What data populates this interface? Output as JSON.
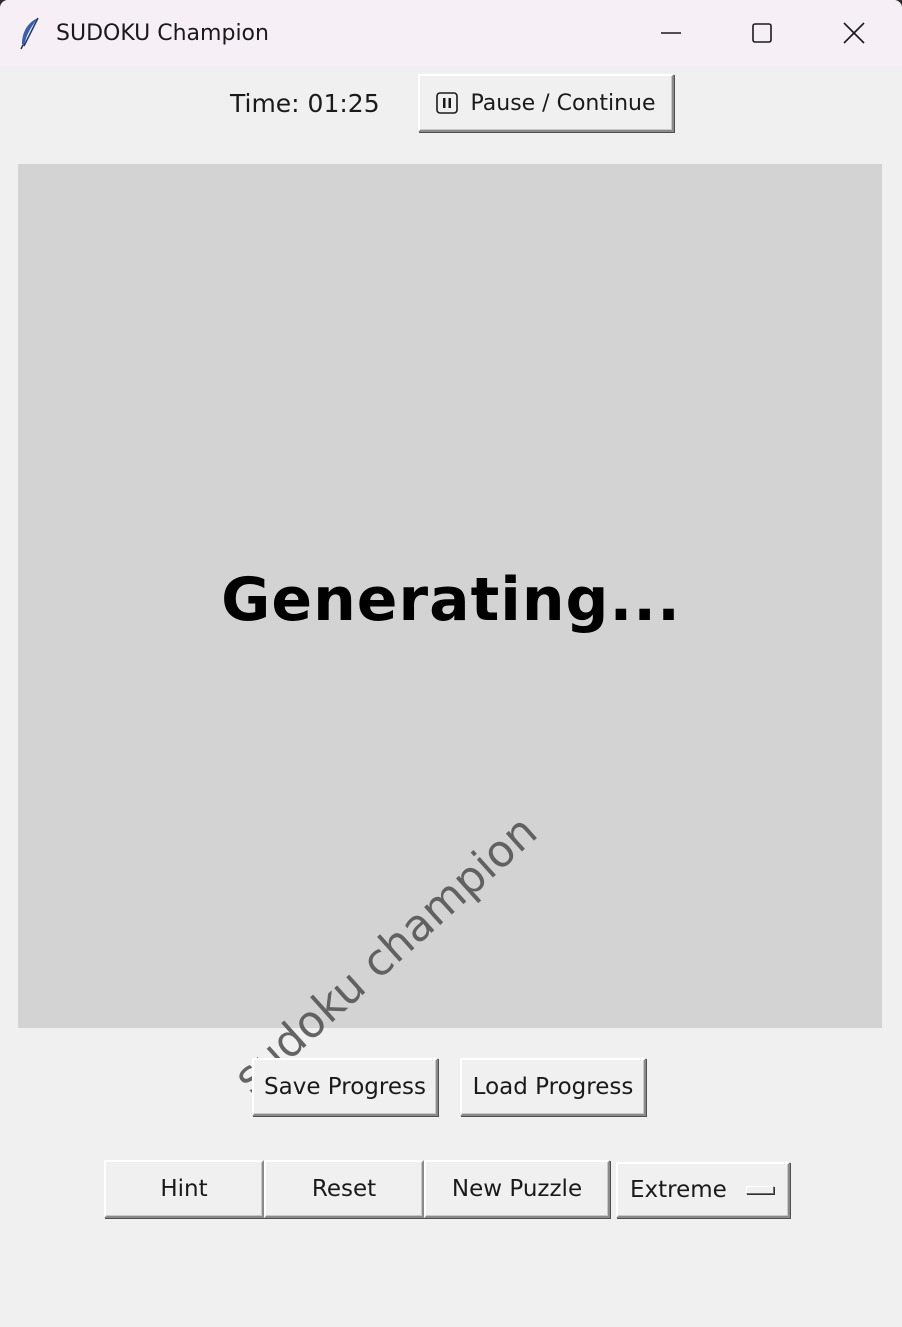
{
  "window": {
    "title": "SUDOKU Champion",
    "icon": "feather-icon"
  },
  "controls": {
    "minimize_icon": "minimize-icon",
    "maximize_icon": "maximize-icon",
    "close_icon": "close-icon"
  },
  "header": {
    "timer_text": "Time: 01:25",
    "pause_label": "Pause / Continue",
    "pause_icon": "pause-icon"
  },
  "board": {
    "status_text": "Generating...",
    "watermark": "sudoku champion",
    "background_color": "#d3d3d3"
  },
  "actions": {
    "save_label": "Save Progress",
    "load_label": "Load Progress",
    "hint_label": "Hint",
    "reset_label": "Reset",
    "new_puzzle_label": "New Puzzle",
    "difficulty_selected": "Extreme"
  }
}
